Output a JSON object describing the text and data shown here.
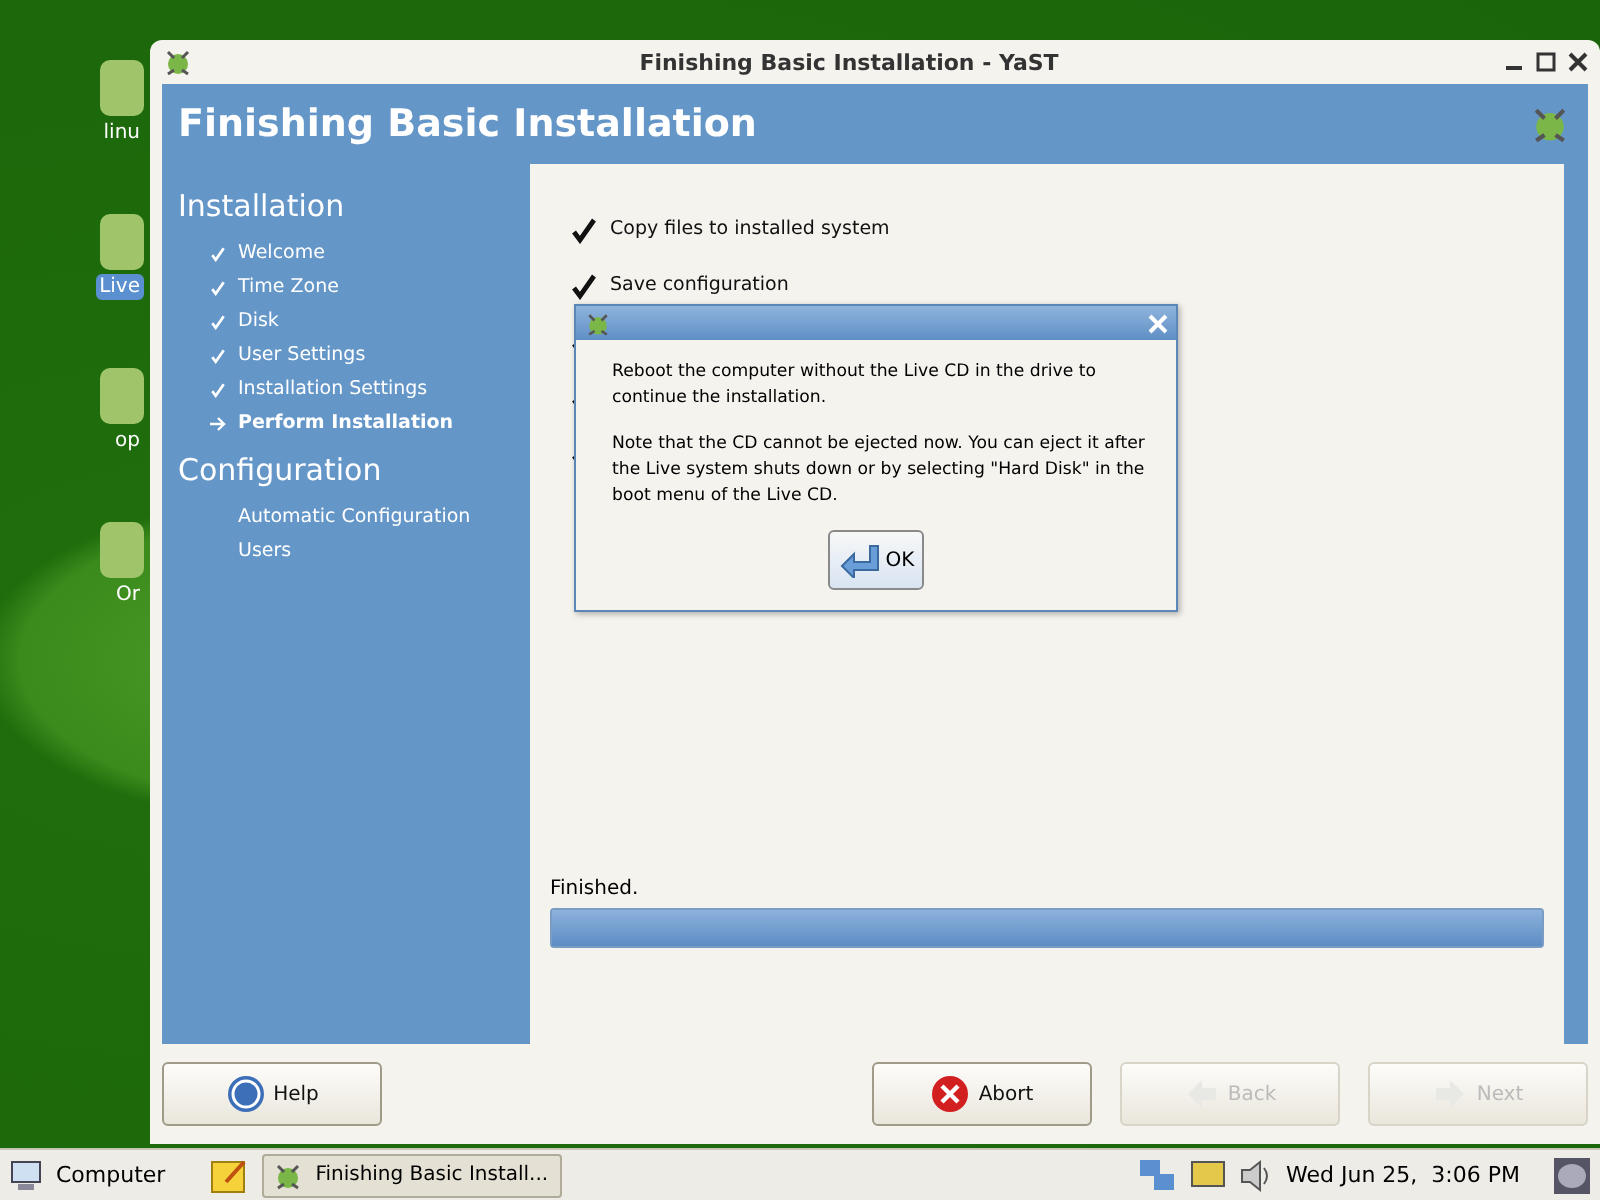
{
  "desktop_icons": [
    {
      "label": "linu",
      "selected": false
    },
    {
      "label": "Live",
      "selected": true
    },
    {
      "label": "op",
      "selected": false
    },
    {
      "label": "Or",
      "selected": false
    }
  ],
  "window": {
    "title": "Finishing Basic Installation - YaST",
    "heading": "Finishing Basic Installation"
  },
  "sidebar": {
    "sections": [
      {
        "title": "Installation",
        "items": [
          {
            "label": "Welcome",
            "done": true,
            "selected": false
          },
          {
            "label": "Time Zone",
            "done": true,
            "selected": false
          },
          {
            "label": "Disk",
            "done": true,
            "selected": false
          },
          {
            "label": "User Settings",
            "done": true,
            "selected": false
          },
          {
            "label": "Installation Settings",
            "done": true,
            "selected": false
          },
          {
            "label": "Perform Installation",
            "selected": true
          }
        ]
      },
      {
        "title": "Configuration",
        "items": [
          {
            "label": "Automatic Configuration",
            "done": false,
            "selected": false
          },
          {
            "label": "Users",
            "done": false,
            "selected": false
          }
        ]
      }
    ]
  },
  "steps": [
    {
      "label": "Copy files to installed system",
      "done": true
    },
    {
      "label": "Save configuration",
      "done": true
    },
    {
      "done": true
    },
    {
      "done": true
    },
    {
      "done": true
    }
  ],
  "progress": {
    "label": "Finished.",
    "level": 1
  },
  "dialog": {
    "paragraphs": [
      "Reboot the computer without the Live CD in the drive to continue the installation.",
      "Note that the CD cannot be ejected now. You can eject it after the Live system shuts down or by selecting \"Hard Disk\" in the boot menu of the Live CD."
    ],
    "button": "OK"
  },
  "buttons": [
    {
      "kind": "help",
      "label": "Help",
      "disabled": false
    },
    {
      "kind": "abort",
      "label": "Abort",
      "disabled": false
    },
    {
      "kind": "back",
      "label": "Back",
      "disabled": true
    },
    {
      "kind": "next",
      "label": "Next",
      "disabled": true
    }
  ],
  "taskbar": {
    "menu": "Computer",
    "task": "Finishing Basic Install...",
    "clock": "Wed Jun 25,  3:06 PM"
  }
}
